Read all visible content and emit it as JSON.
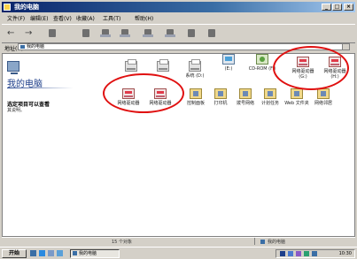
{
  "window": {
    "title": "我的电脑",
    "controls": {
      "minimize": "_",
      "maximize": "□",
      "close": "×"
    }
  },
  "menu": [
    "文件(F)",
    "编辑(E)",
    "查看(V)",
    "收藏(A)",
    "工具(T)",
    "帮助(H)"
  ],
  "toolbar": {
    "buttons": [
      {
        "name": "back-icon",
        "glyph": "←"
      },
      {
        "name": "forward-icon",
        "glyph": "→"
      },
      {
        "name": "up-icon",
        "glyph": ""
      },
      {
        "name": "cut-icon",
        "glyph": ""
      },
      {
        "name": "copy-icon",
        "glyph": ""
      },
      {
        "name": "paste-icon",
        "glyph": ""
      },
      {
        "name": "undo-icon",
        "glyph": ""
      },
      {
        "name": "delete-icon",
        "glyph": ""
      },
      {
        "name": "properties-icon",
        "glyph": ""
      },
      {
        "name": "views-icon",
        "glyph": ""
      }
    ]
  },
  "address": {
    "label": "地址(D)",
    "value": "我的电脑"
  },
  "left_pane": {
    "title": "我的电脑",
    "description": "选定项目可以查看",
    "description2": "其说明。"
  },
  "items": [
    {
      "name": "drive-a",
      "type": "printer",
      "label": ""
    },
    {
      "name": "drive-c",
      "type": "printer",
      "label": ""
    },
    {
      "name": "drive-d",
      "type": "printer",
      "label": "系统 (D:)"
    },
    {
      "name": "drive-e",
      "type": "printer",
      "label": "(E:)"
    },
    {
      "name": "cd-drive",
      "type": "cd",
      "label": "CD-ROM (F:)"
    },
    {
      "name": "net-drive-1",
      "type": "netprinter",
      "label": "网络驱动器 (G:)"
    },
    {
      "name": "net-drive-2",
      "type": "netprinter",
      "label": "网络驱动器 (H:)"
    },
    {
      "name": "net-drive-3",
      "type": "netprinter",
      "label": "网络驱动器"
    },
    {
      "name": "net-drive-4",
      "type": "netprinter",
      "label": "网络驱动器"
    },
    {
      "name": "control-panel",
      "type": "folder",
      "label": "控制面板"
    },
    {
      "name": "printers",
      "type": "folder",
      "label": "打印机"
    },
    {
      "name": "dialup",
      "type": "folder",
      "label": "拨号网络"
    },
    {
      "name": "scheduled",
      "type": "monitor",
      "label": "计划任务"
    },
    {
      "name": "web-folders",
      "type": "folder",
      "label": "Web 文件夹"
    },
    {
      "name": "network-places",
      "type": "folder",
      "label": "网络邻居"
    }
  ],
  "status": {
    "left": "15 个对象",
    "right": "我的电脑"
  },
  "taskbar": {
    "start": "开始",
    "task": "我的电脑",
    "clock": "10:30"
  },
  "colors": {
    "annotation": "#e01010",
    "titlebar": "#0a246a"
  }
}
